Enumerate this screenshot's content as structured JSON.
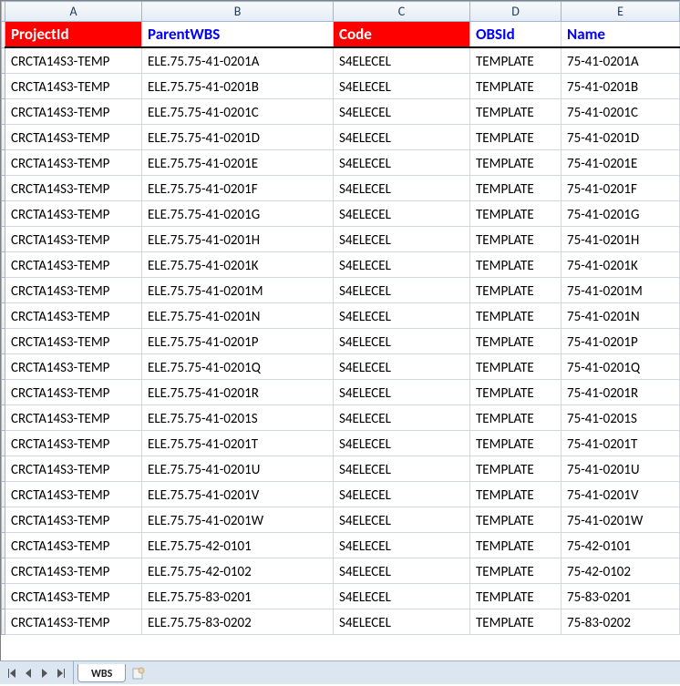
{
  "columns": [
    "A",
    "B",
    "C",
    "D",
    "E",
    ""
  ],
  "headers": [
    {
      "label": "ProjectId",
      "style": "red"
    },
    {
      "label": "ParentWBS",
      "style": "blue"
    },
    {
      "label": "Code",
      "style": "red"
    },
    {
      "label": "OBSId",
      "style": "blue"
    },
    {
      "label": "Name",
      "style": "blue"
    }
  ],
  "chart_data": {
    "type": "table",
    "columns": [
      "ProjectId",
      "ParentWBS",
      "Code",
      "OBSId",
      "Name"
    ],
    "rows": [
      [
        "CRCTA14S3-TEMP",
        "ELE.75.75-41-0201A",
        "S4ELECEL",
        "TEMPLATE",
        "75-41-0201A"
      ],
      [
        "CRCTA14S3-TEMP",
        "ELE.75.75-41-0201B",
        "S4ELECEL",
        "TEMPLATE",
        "75-41-0201B"
      ],
      [
        "CRCTA14S3-TEMP",
        "ELE.75.75-41-0201C",
        "S4ELECEL",
        "TEMPLATE",
        "75-41-0201C"
      ],
      [
        "CRCTA14S3-TEMP",
        "ELE.75.75-41-0201D",
        "S4ELECEL",
        "TEMPLATE",
        "75-41-0201D"
      ],
      [
        "CRCTA14S3-TEMP",
        "ELE.75.75-41-0201E",
        "S4ELECEL",
        "TEMPLATE",
        "75-41-0201E"
      ],
      [
        "CRCTA14S3-TEMP",
        "ELE.75.75-41-0201F",
        "S4ELECEL",
        "TEMPLATE",
        "75-41-0201F"
      ],
      [
        "CRCTA14S3-TEMP",
        "ELE.75.75-41-0201G",
        "S4ELECEL",
        "TEMPLATE",
        "75-41-0201G"
      ],
      [
        "CRCTA14S3-TEMP",
        "ELE.75.75-41-0201H",
        "S4ELECEL",
        "TEMPLATE",
        "75-41-0201H"
      ],
      [
        "CRCTA14S3-TEMP",
        "ELE.75.75-41-0201K",
        "S4ELECEL",
        "TEMPLATE",
        "75-41-0201K"
      ],
      [
        "CRCTA14S3-TEMP",
        "ELE.75.75-41-0201M",
        "S4ELECEL",
        "TEMPLATE",
        "75-41-0201M"
      ],
      [
        "CRCTA14S3-TEMP",
        "ELE.75.75-41-0201N",
        "S4ELECEL",
        "TEMPLATE",
        "75-41-0201N"
      ],
      [
        "CRCTA14S3-TEMP",
        "ELE.75.75-41-0201P",
        "S4ELECEL",
        "TEMPLATE",
        "75-41-0201P"
      ],
      [
        "CRCTA14S3-TEMP",
        "ELE.75.75-41-0201Q",
        "S4ELECEL",
        "TEMPLATE",
        "75-41-0201Q"
      ],
      [
        "CRCTA14S3-TEMP",
        "ELE.75.75-41-0201R",
        "S4ELECEL",
        "TEMPLATE",
        "75-41-0201R"
      ],
      [
        "CRCTA14S3-TEMP",
        "ELE.75.75-41-0201S",
        "S4ELECEL",
        "TEMPLATE",
        "75-41-0201S"
      ],
      [
        "CRCTA14S3-TEMP",
        "ELE.75.75-41-0201T",
        "S4ELECEL",
        "TEMPLATE",
        "75-41-0201T"
      ],
      [
        "CRCTA14S3-TEMP",
        "ELE.75.75-41-0201U",
        "S4ELECEL",
        "TEMPLATE",
        "75-41-0201U"
      ],
      [
        "CRCTA14S3-TEMP",
        "ELE.75.75-41-0201V",
        "S4ELECEL",
        "TEMPLATE",
        "75-41-0201V"
      ],
      [
        "CRCTA14S3-TEMP",
        "ELE.75.75-41-0201W",
        "S4ELECEL",
        "TEMPLATE",
        "75-41-0201W"
      ],
      [
        "CRCTA14S3-TEMP",
        "ELE.75.75-42-0101",
        "S4ELECEL",
        "TEMPLATE",
        "75-42-0101"
      ],
      [
        "CRCTA14S3-TEMP",
        "ELE.75.75-42-0102",
        "S4ELECEL",
        "TEMPLATE",
        "75-42-0102"
      ],
      [
        "CRCTA14S3-TEMP",
        "ELE.75.75-83-0201",
        "S4ELECEL",
        "TEMPLATE",
        "75-83-0201"
      ],
      [
        "CRCTA14S3-TEMP",
        "ELE.75.75-83-0202",
        "S4ELECEL",
        "TEMPLATE",
        "75-83-0202"
      ]
    ]
  },
  "tabs": {
    "active": "WBS"
  }
}
